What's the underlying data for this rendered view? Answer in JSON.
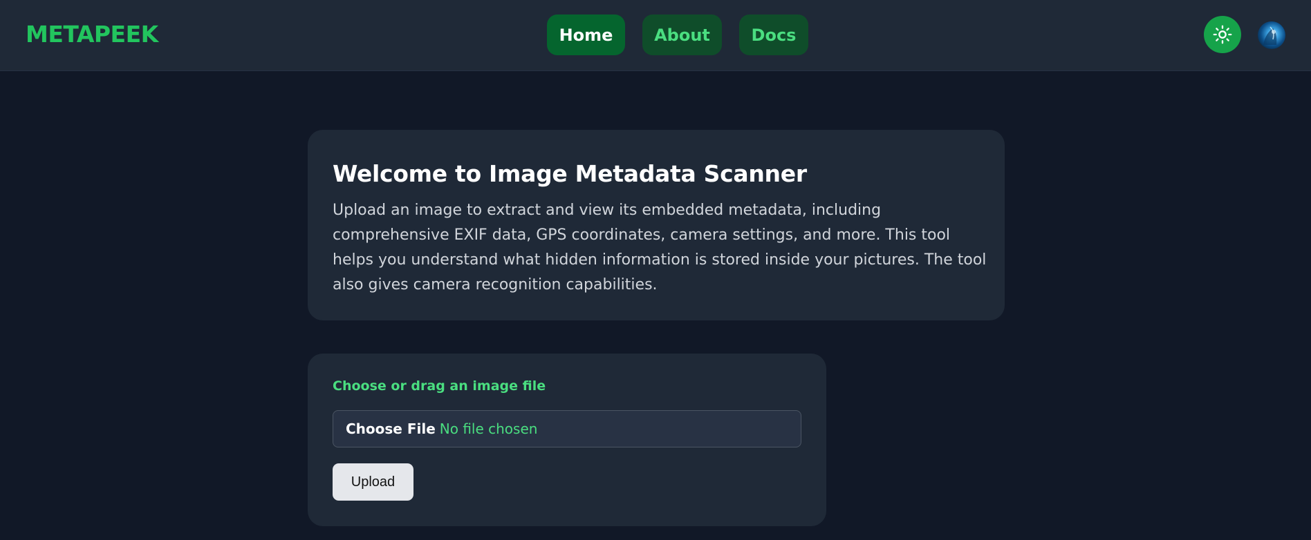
{
  "app": {
    "brand": "METAPEEK"
  },
  "nav": {
    "items": [
      {
        "label": "Home"
      },
      {
        "label": "About"
      },
      {
        "label": "Docs"
      }
    ]
  },
  "header_icons": {
    "theme_toggle": "sun-icon",
    "avatar": "avatar"
  },
  "welcome": {
    "title": "Welcome to Image Metadata Scanner",
    "body": "Upload an image to extract and view its embedded metadata, including comprehensive EXIF data, GPS coordinates, camera settings, and more. This tool helps you understand what hidden information is stored inside your pictures. The tool also gives camera recognition capabilities."
  },
  "upload": {
    "label": "Choose or drag an image file",
    "choose_file": "Choose File",
    "no_file": "No file chosen",
    "button": "Upload"
  },
  "colors": {
    "accent": "#22c55e",
    "background": "#111827",
    "card": "#1f2937"
  }
}
